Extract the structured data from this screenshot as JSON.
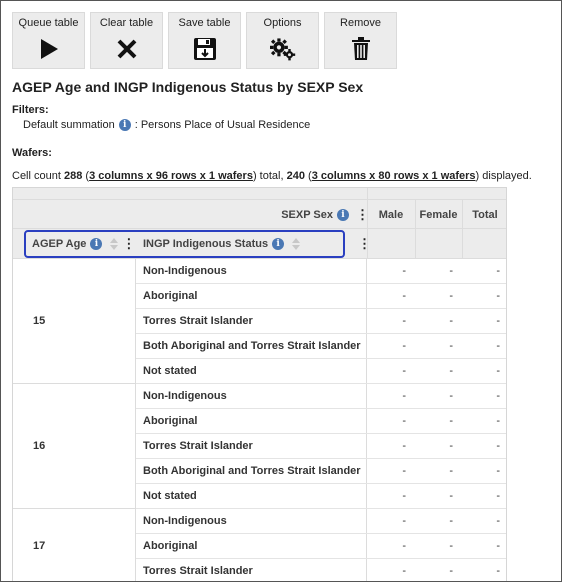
{
  "toolbar": [
    {
      "label": "Queue table",
      "icon": "play-icon"
    },
    {
      "label": "Clear table",
      "icon": "close-icon"
    },
    {
      "label": "Save table",
      "icon": "save-icon"
    },
    {
      "label": "Options",
      "icon": "gears-icon"
    },
    {
      "label": "Remove",
      "icon": "trash-icon"
    }
  ],
  "title": "AGEP Age and INGP Indigenous Status by SEXP Sex",
  "filters": {
    "heading": "Filters:",
    "label": "Default summation",
    "value": ": Persons Place of Usual Residence"
  },
  "wafers": {
    "heading": "Wafers:"
  },
  "cellcount": {
    "prefix": "Cell count",
    "total": "288",
    "total_dims": "3 columns x 96 rows x 1 wafers",
    "mid": "total,",
    "displayed": "240",
    "displayed_dims": "3 columns x 80 rows x 1 wafers",
    "suffix": "displayed."
  },
  "table": {
    "column_var": "SEXP Sex",
    "columns": [
      "Male",
      "Female",
      "Total"
    ],
    "row_vars": [
      "AGEP Age",
      "INGP Indigenous Status"
    ],
    "groups": [
      {
        "age": "15",
        "rows": [
          {
            "label": "Non-Indigenous",
            "values": [
              "-",
              "-",
              "-"
            ]
          },
          {
            "label": "Aboriginal",
            "values": [
              "-",
              "-",
              "-"
            ]
          },
          {
            "label": "Torres Strait Islander",
            "values": [
              "-",
              "-",
              "-"
            ]
          },
          {
            "label": "Both Aboriginal and Torres Strait Islander",
            "values": [
              "-",
              "-",
              "-"
            ]
          },
          {
            "label": "Not stated",
            "values": [
              "-",
              "-",
              "-"
            ]
          }
        ]
      },
      {
        "age": "16",
        "rows": [
          {
            "label": "Non-Indigenous",
            "values": [
              "-",
              "-",
              "-"
            ]
          },
          {
            "label": "Aboriginal",
            "values": [
              "-",
              "-",
              "-"
            ]
          },
          {
            "label": "Torres Strait Islander",
            "values": [
              "-",
              "-",
              "-"
            ]
          },
          {
            "label": "Both Aboriginal and Torres Strait Islander",
            "values": [
              "-",
              "-",
              "-"
            ]
          },
          {
            "label": "Not stated",
            "values": [
              "-",
              "-",
              "-"
            ]
          }
        ]
      },
      {
        "age": "17",
        "rows": [
          {
            "label": "Non-Indigenous",
            "values": [
              "-",
              "-",
              "-"
            ]
          },
          {
            "label": "Aboriginal",
            "values": [
              "-",
              "-",
              "-"
            ]
          },
          {
            "label": "Torres Strait Islander",
            "values": [
              "-",
              "-",
              "-"
            ]
          }
        ]
      }
    ]
  }
}
